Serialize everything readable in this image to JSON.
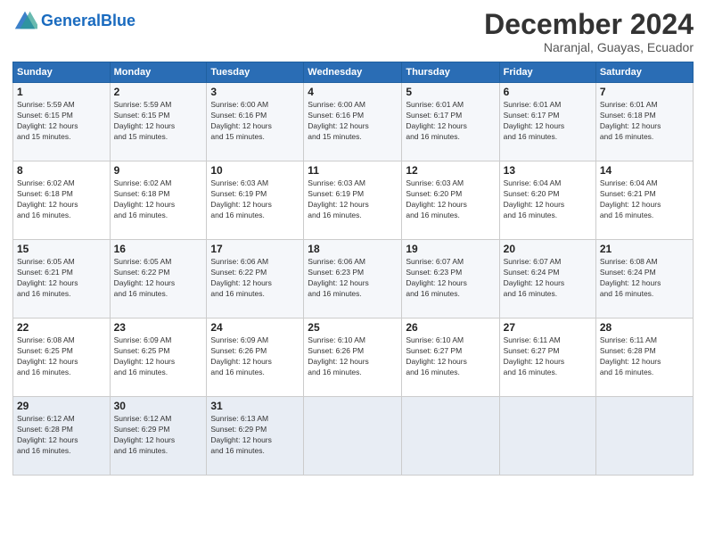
{
  "logo": {
    "text_general": "General",
    "text_blue": "Blue"
  },
  "header": {
    "month": "December 2024",
    "location": "Naranjal, Guayas, Ecuador"
  },
  "weekdays": [
    "Sunday",
    "Monday",
    "Tuesday",
    "Wednesday",
    "Thursday",
    "Friday",
    "Saturday"
  ],
  "weeks": [
    [
      {
        "day": "1",
        "sunrise": "5:59 AM",
        "sunset": "6:15 PM",
        "daylight": "12 hours and 15 minutes."
      },
      {
        "day": "2",
        "sunrise": "5:59 AM",
        "sunset": "6:15 PM",
        "daylight": "12 hours and 15 minutes."
      },
      {
        "day": "3",
        "sunrise": "6:00 AM",
        "sunset": "6:16 PM",
        "daylight": "12 hours and 15 minutes."
      },
      {
        "day": "4",
        "sunrise": "6:00 AM",
        "sunset": "6:16 PM",
        "daylight": "12 hours and 15 minutes."
      },
      {
        "day": "5",
        "sunrise": "6:01 AM",
        "sunset": "6:17 PM",
        "daylight": "12 hours and 16 minutes."
      },
      {
        "day": "6",
        "sunrise": "6:01 AM",
        "sunset": "6:17 PM",
        "daylight": "12 hours and 16 minutes."
      },
      {
        "day": "7",
        "sunrise": "6:01 AM",
        "sunset": "6:18 PM",
        "daylight": "12 hours and 16 minutes."
      }
    ],
    [
      {
        "day": "8",
        "sunrise": "6:02 AM",
        "sunset": "6:18 PM",
        "daylight": "12 hours and 16 minutes."
      },
      {
        "day": "9",
        "sunrise": "6:02 AM",
        "sunset": "6:18 PM",
        "daylight": "12 hours and 16 minutes."
      },
      {
        "day": "10",
        "sunrise": "6:03 AM",
        "sunset": "6:19 PM",
        "daylight": "12 hours and 16 minutes."
      },
      {
        "day": "11",
        "sunrise": "6:03 AM",
        "sunset": "6:19 PM",
        "daylight": "12 hours and 16 minutes."
      },
      {
        "day": "12",
        "sunrise": "6:03 AM",
        "sunset": "6:20 PM",
        "daylight": "12 hours and 16 minutes."
      },
      {
        "day": "13",
        "sunrise": "6:04 AM",
        "sunset": "6:20 PM",
        "daylight": "12 hours and 16 minutes."
      },
      {
        "day": "14",
        "sunrise": "6:04 AM",
        "sunset": "6:21 PM",
        "daylight": "12 hours and 16 minutes."
      }
    ],
    [
      {
        "day": "15",
        "sunrise": "6:05 AM",
        "sunset": "6:21 PM",
        "daylight": "12 hours and 16 minutes."
      },
      {
        "day": "16",
        "sunrise": "6:05 AM",
        "sunset": "6:22 PM",
        "daylight": "12 hours and 16 minutes."
      },
      {
        "day": "17",
        "sunrise": "6:06 AM",
        "sunset": "6:22 PM",
        "daylight": "12 hours and 16 minutes."
      },
      {
        "day": "18",
        "sunrise": "6:06 AM",
        "sunset": "6:23 PM",
        "daylight": "12 hours and 16 minutes."
      },
      {
        "day": "19",
        "sunrise": "6:07 AM",
        "sunset": "6:23 PM",
        "daylight": "12 hours and 16 minutes."
      },
      {
        "day": "20",
        "sunrise": "6:07 AM",
        "sunset": "6:24 PM",
        "daylight": "12 hours and 16 minutes."
      },
      {
        "day": "21",
        "sunrise": "6:08 AM",
        "sunset": "6:24 PM",
        "daylight": "12 hours and 16 minutes."
      }
    ],
    [
      {
        "day": "22",
        "sunrise": "6:08 AM",
        "sunset": "6:25 PM",
        "daylight": "12 hours and 16 minutes."
      },
      {
        "day": "23",
        "sunrise": "6:09 AM",
        "sunset": "6:25 PM",
        "daylight": "12 hours and 16 minutes."
      },
      {
        "day": "24",
        "sunrise": "6:09 AM",
        "sunset": "6:26 PM",
        "daylight": "12 hours and 16 minutes."
      },
      {
        "day": "25",
        "sunrise": "6:10 AM",
        "sunset": "6:26 PM",
        "daylight": "12 hours and 16 minutes."
      },
      {
        "day": "26",
        "sunrise": "6:10 AM",
        "sunset": "6:27 PM",
        "daylight": "12 hours and 16 minutes."
      },
      {
        "day": "27",
        "sunrise": "6:11 AM",
        "sunset": "6:27 PM",
        "daylight": "12 hours and 16 minutes."
      },
      {
        "day": "28",
        "sunrise": "6:11 AM",
        "sunset": "6:28 PM",
        "daylight": "12 hours and 16 minutes."
      }
    ],
    [
      {
        "day": "29",
        "sunrise": "6:12 AM",
        "sunset": "6:28 PM",
        "daylight": "12 hours and 16 minutes."
      },
      {
        "day": "30",
        "sunrise": "6:12 AM",
        "sunset": "6:29 PM",
        "daylight": "12 hours and 16 minutes."
      },
      {
        "day": "31",
        "sunrise": "6:13 AM",
        "sunset": "6:29 PM",
        "daylight": "12 hours and 16 minutes."
      },
      null,
      null,
      null,
      null
    ]
  ]
}
